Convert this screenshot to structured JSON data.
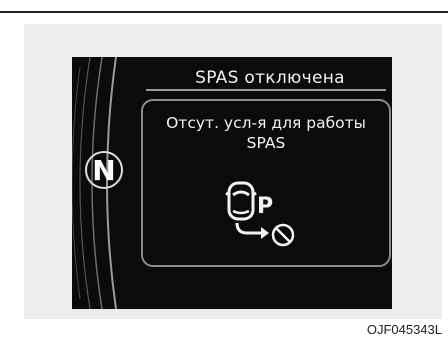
{
  "screen": {
    "title": "SPAS отключена",
    "gear_indicator": "N",
    "message_line1": "Отсут. усл-я для работы",
    "message_line2": "SPAS",
    "icon": "spas-unavailable-icon",
    "icon_letter": "P"
  },
  "caption": "OJF045343L",
  "colors": {
    "display_background": "#0b0b0b",
    "frame_background": "#ececec",
    "text": "#f2f2f2"
  }
}
